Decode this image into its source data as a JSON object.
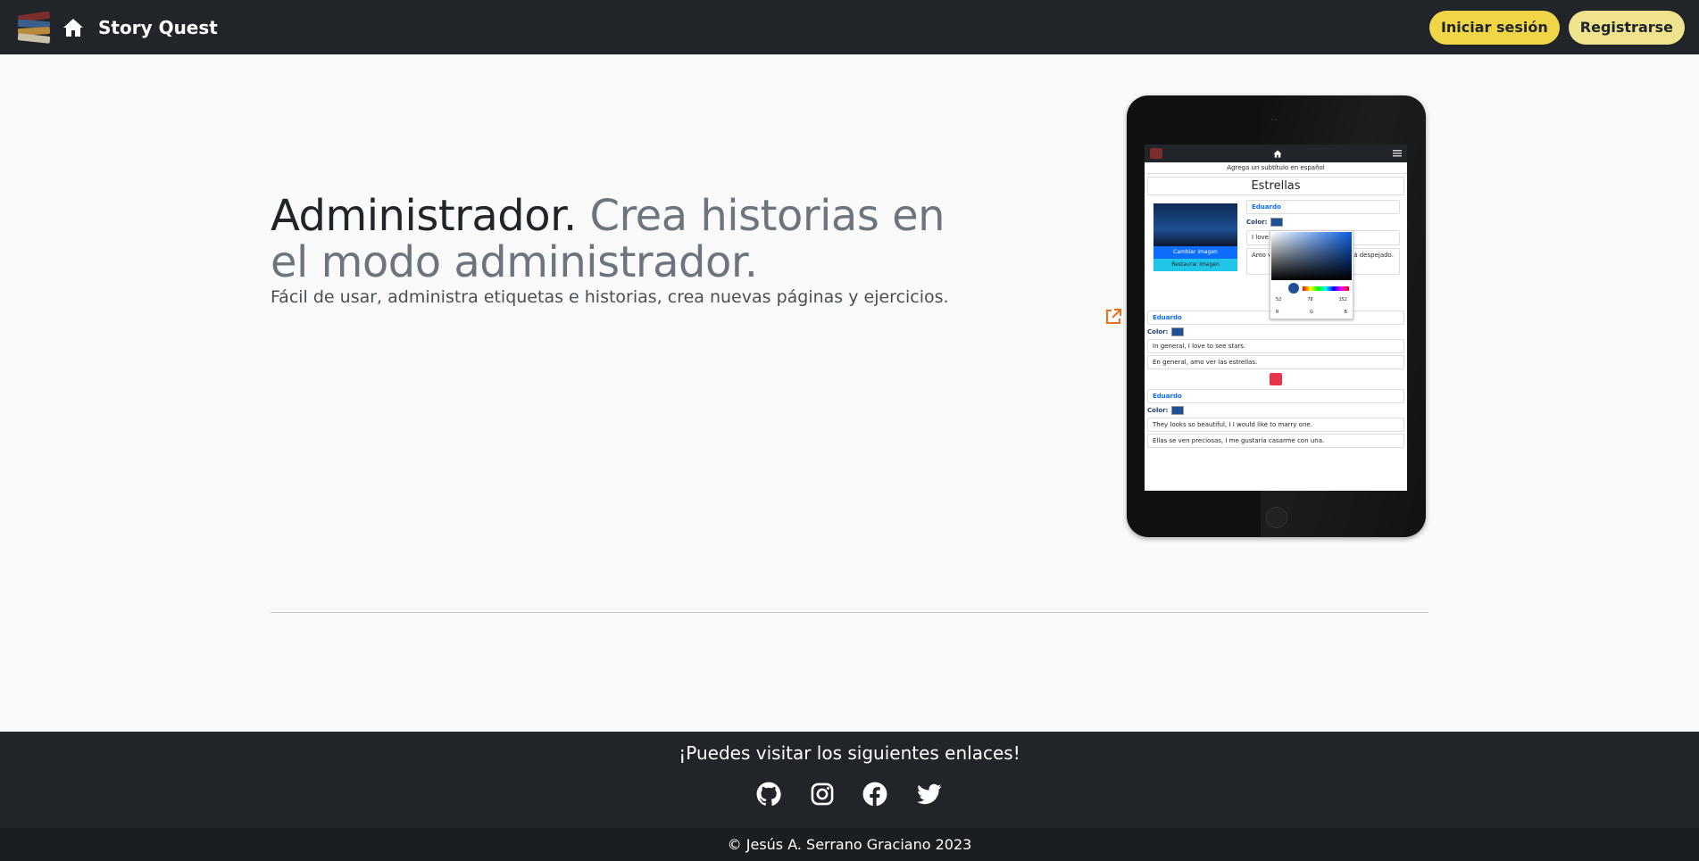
{
  "navbar": {
    "brand": "Story Quest",
    "logo_icon": "books-logo-icon",
    "home_icon": "home-icon",
    "login_label": "Iniciar sesión",
    "register_label": "Registrarse",
    "colors": {
      "background": "#212529",
      "login_bg": "#f0d647",
      "register_bg": "#efe38d"
    }
  },
  "hero": {
    "title_strong": "Administrador.",
    "title_muted": "Crea historias en el modo administrador.",
    "lead": "Fácil de usar, administra etiquetas e historias, crea nuevas páginas y ejercicios.",
    "external_link_icon": "external-link-icon"
  },
  "tablet_screen": {
    "subtitle_placeholder": "Agrega un subtítulo en español",
    "story_title": "Estrellas",
    "image_buttons": [
      "Cambiar imagen",
      "Restaurar imagen"
    ],
    "color_picker": {
      "r": "52",
      "g": "78",
      "b": "152",
      "labels": [
        "R",
        "G",
        "B"
      ]
    },
    "blocks": [
      {
        "name": "Eduardo",
        "color_label": "Color:",
        "text_en": "I love to see the stars",
        "text_es": "Amo ver las estrellas cuando está despejado."
      },
      {
        "name": "Eduardo",
        "color_label": "Color:",
        "text_en": "In general, I love to see stars.",
        "text_es": "En general, amo ver las estrellas."
      },
      {
        "name": "Eduardo",
        "color_label": "Color:",
        "text_en": "They looks so beautiful, I I would like to marry one.",
        "text_es": "Ellas se ven preciosas, I me gustaría casarme con una."
      }
    ]
  },
  "footer": {
    "links_text": "¡Puedes visitar los siguientes enlaces!",
    "social_icons": [
      "github-icon",
      "instagram-icon",
      "facebook-icon",
      "twitter-icon"
    ],
    "copyright": "© Jesús A. Serrano Graciano 2023"
  }
}
